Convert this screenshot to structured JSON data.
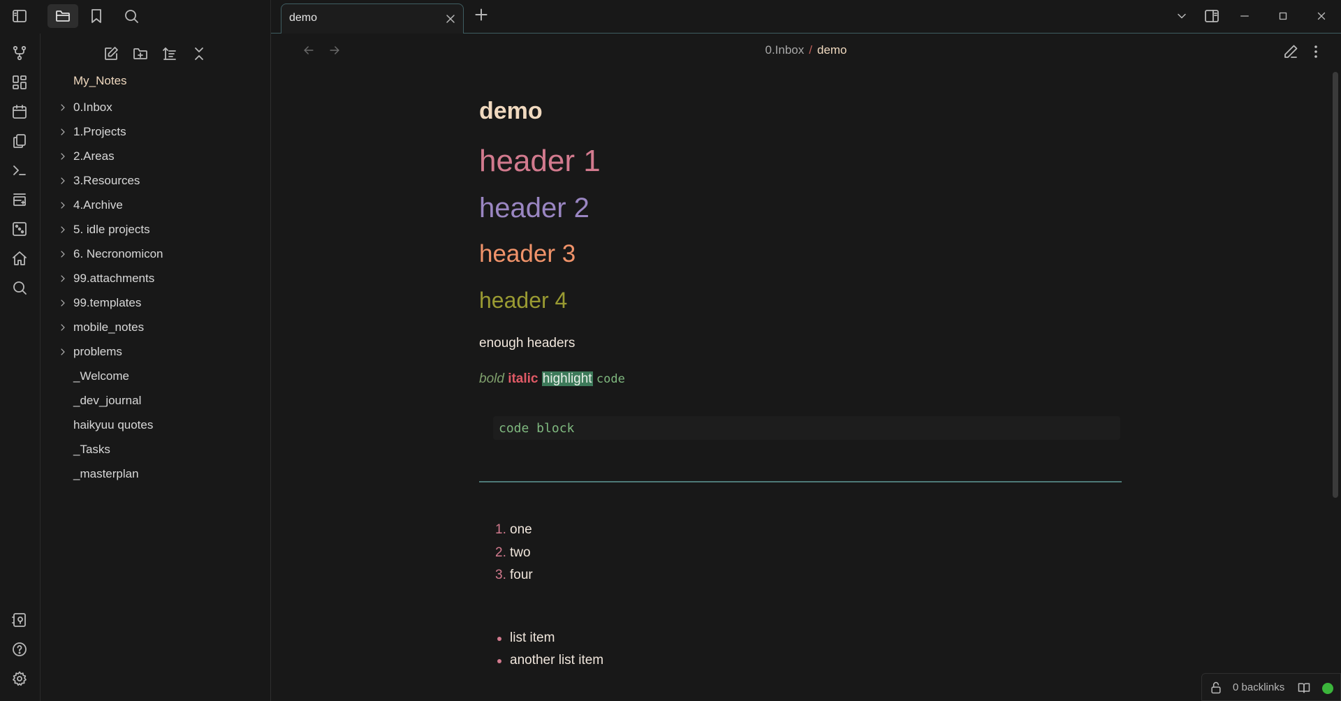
{
  "titlebar": {
    "left_icons": [
      "sidebar-toggle-icon",
      "folder-icon",
      "bookmark-icon",
      "search-icon"
    ],
    "active_tab": {
      "title": "demo",
      "close_icon": "close-icon"
    },
    "new_tab_icon": "plus-icon",
    "right_icons": [
      "chevron-down-icon",
      "right-sidebar-toggle-icon",
      "minimize-icon",
      "maximize-icon",
      "close-icon"
    ]
  },
  "ribbon": {
    "top_icons": [
      "graph-icon",
      "dashboard-icon",
      "calendar-icon",
      "copy-icon",
      "terminal-icon",
      "kanban-icon",
      "dice-icon",
      "home-icon",
      "search-icon"
    ],
    "bottom_icons": [
      "vault-switcher-icon",
      "help-icon",
      "settings-icon"
    ]
  },
  "explorer": {
    "toolbar_icons": [
      "new-note-icon",
      "new-folder-icon",
      "sort-icon",
      "collapse-all-icon"
    ],
    "vault_name": "My_Notes",
    "folders": [
      "0.Inbox",
      "1.Projects",
      "2.Areas",
      "3.Resources",
      "4.Archive",
      "5. idle projects",
      "6. Necronomicon",
      "99.attachments",
      "99.templates",
      "mobile_notes",
      "problems"
    ],
    "files": [
      "_Welcome",
      "_dev_journal",
      "haikyuu quotes",
      "_Tasks",
      "_masterplan"
    ]
  },
  "editor": {
    "breadcrumb": {
      "parent": "0.Inbox",
      "separator": "/",
      "current": "demo"
    },
    "note_title": "demo",
    "h1": "header 1",
    "h2": "header 2",
    "h3": "header 3",
    "h4": "header 4",
    "paragraph": "enough headers",
    "inline": {
      "bold": "bold",
      "italic": "italic",
      "highlight": "highlight",
      "code": "code"
    },
    "code_block": "code block",
    "ordered_list": [
      {
        "num": "1.",
        "text": "one"
      },
      {
        "num": "2.",
        "text": "two"
      },
      {
        "num": "3.",
        "text": "four"
      }
    ],
    "bullet_list": [
      "list item",
      "another list item"
    ]
  },
  "statusbar": {
    "backlinks": "0 backlinks",
    "sync_color": "#3bb53b"
  },
  "colors": {
    "background": "#181818",
    "accent_border": "#3f5e62",
    "h1": "#d27a8e",
    "h2": "#9a86c2",
    "h3": "#f0936a",
    "h4": "#999a32",
    "highlight": "#3d7a5a",
    "code": "#7fb87f"
  }
}
